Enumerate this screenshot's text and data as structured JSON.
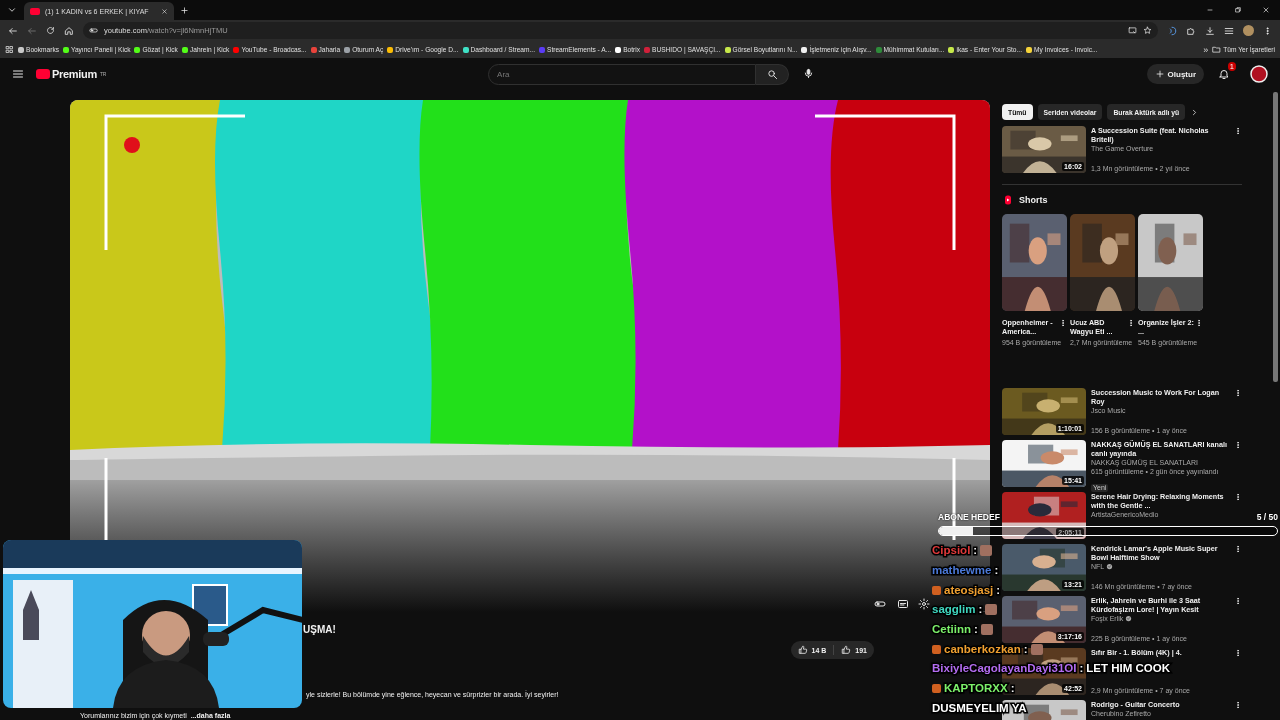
{
  "browser": {
    "tabs": [
      {
        "title": "(1) 1 KADIN vs 6 ERKEK | KIYAF",
        "selected": true
      }
    ],
    "address": {
      "host": "youtube.com",
      "path": "/watch?v=jl6NmnHjTMU"
    },
    "bookmarks": [
      {
        "label": "Bookmarks",
        "color": "#c8c8c8"
      },
      {
        "label": "Yayıncı Paneli | Kick",
        "color": "#53fc18"
      },
      {
        "label": "Gözat | Kick",
        "color": "#53fc18"
      },
      {
        "label": "Jahrein | Kick",
        "color": "#53fc18"
      },
      {
        "label": "YouTube - Broadcas...",
        "color": "#ff0000"
      },
      {
        "label": "Jaharia",
        "color": "#e8433b"
      },
      {
        "label": "Oturum Aç",
        "color": "#9aa0a6"
      },
      {
        "label": "Drive'ım - Google D...",
        "color": "#fbbc04"
      },
      {
        "label": "Dashboard / Stream...",
        "color": "#3fe0c5"
      },
      {
        "label": "StreamElements - A...",
        "color": "#5b3cf5"
      },
      {
        "label": "Botrix",
        "color": "#ffffff"
      },
      {
        "label": "BUSHIDO | SAVAŞÇI...",
        "color": "#d0203a"
      },
      {
        "label": "Görsel Boyutlarını N...",
        "color": "#c6e84a"
      },
      {
        "label": "İşletmeniz için Alışv...",
        "color": "#f0f0f0"
      },
      {
        "label": "Mühimmat Kutuları...",
        "color": "#2e8b3a"
      },
      {
        "label": "ikas - Enter Your Sto...",
        "color": "#c6e84a"
      },
      {
        "label": "My Invoices - Invoic...",
        "color": "#f5d33a"
      }
    ],
    "more_bookmarks": "»",
    "all_bookmarks": "Tüm Yer İşaretleri"
  },
  "youtube": {
    "logo": "Premium",
    "region": "TR",
    "search": {
      "placeholder": "Ara"
    },
    "create": "Oluştur",
    "notifications": "1"
  },
  "player": {
    "title": "UŞMA!",
    "likes": "14 B",
    "dislikes": "191",
    "description": "yle sizlerle! Bu bölümde yine eğlence, heyecan ve sürprizler bir arada. İyi seyirler!",
    "comment_note": "Yorumlarınız bizim için çok kıymeti",
    "more": "...daha fazla"
  },
  "sidebar": {
    "chips": [
      {
        "label": "Tümü",
        "selected": true
      },
      {
        "label": "Seriden videolar",
        "selected": false
      },
      {
        "label": "Burak Aktürk adlı yü",
        "selected": false
      }
    ],
    "feed": [
      {
        "kind": "video",
        "title": "A Succession Suite (feat. Nicholas Britell)",
        "channel": "The Game Overture",
        "meta": "1,3 Mn görüntüleme • 2 yıl önce",
        "duration": "16:02",
        "verified": false
      },
      {
        "kind": "shorts",
        "heading": "Shorts",
        "items": [
          {
            "title": "Oppenheimer - America...",
            "views": "954 B görüntüleme"
          },
          {
            "title": "Ucuz ABD Wagyu Eti ...",
            "views": "2,7 Mn görüntüleme"
          },
          {
            "title": "Organize İşler 2: ...",
            "views": "545 B görüntüleme"
          }
        ]
      },
      {
        "kind": "video",
        "title": "Succession Music to Work For Logan Roy",
        "channel": "Jsco Music",
        "meta": "156 B görüntüleme • 1 ay önce",
        "duration": "1:10:01",
        "verified": false
      },
      {
        "kind": "video",
        "title": "NAKKAŞ GÜMÜŞ EL SANATLARI kanalı canlı yayında",
        "channel": "NAKKAŞ GÜMÜŞ EL SANATLARI",
        "meta": "615 görüntüleme • 2 gün önce yayınlandı",
        "badge": "Yeni",
        "duration": "15:41",
        "verified": false
      },
      {
        "kind": "video",
        "title": "Serene Hair Drying: Relaxing Moments with the Gentle ...",
        "channel": "ArtistaGenericoMedio",
        "duration": "2:05:11",
        "verified": false
      },
      {
        "kind": "video",
        "title": "Kendrick Lamar's Apple Music Super Bowl Halftime Show",
        "channel": "NFL",
        "meta": "146 Mn görüntüleme • 7 ay önce",
        "duration": "13:21",
        "verified": true
      },
      {
        "kind": "video",
        "title": "Erlik, Jahrein ve Burhi ile 3 Saat Kürdofaşizm Lore! | Yayın Kesit",
        "channel": "Foşix Erlik",
        "meta": "225 B görüntüleme • 1 ay önce",
        "duration": "3:17:16",
        "verified": true
      },
      {
        "kind": "video",
        "title": "Sıfır Bir - 1. Bölüm (4K) | 4.",
        "meta": "2,9 Mn görüntüleme • 7 ay önce",
        "duration": "42:52",
        "verified": false
      },
      {
        "kind": "video",
        "title": "Rodrigo - Guitar Concerto",
        "channel": "Cherubino Zefiretto",
        "verified": false
      }
    ]
  },
  "overlay": {
    "goal": {
      "label": "ABONE HEDEF",
      "count": "5 / 50",
      "level": 0.1
    },
    "chat": [
      {
        "name": "Cipsiol",
        "color": "#e0393a",
        "sep": ":",
        "badge": false,
        "emote": true
      },
      {
        "name": "mathewme",
        "color": "#4b79d8",
        "sep": ":",
        "badge": false,
        "emote": false
      },
      {
        "name": "ateosjasj",
        "color": "#f0a030",
        "sep": ":",
        "badge": true,
        "emote": false
      },
      {
        "name": "sagglim",
        "color": "#3fd8c0",
        "sep": ":",
        "badge": false,
        "emote": true
      },
      {
        "name": "Cetiinn",
        "color": "#7cf06a",
        "sep": ":",
        "badge": false,
        "emote": true
      },
      {
        "name": "canberkozkan",
        "color": "#f0a030",
        "sep": ":",
        "badge": true,
        "emote": true
      },
      {
        "name": "BixiyleCagolayanDayi31OI",
        "color": "#b36cf0",
        "sep": ":",
        "text": "LET HIM COOK",
        "badge": false,
        "emote": false
      },
      {
        "name": "KAPTORXX",
        "color": "#7cf06a",
        "sep": ":",
        "text": "DUSMEYELIM YA",
        "badge": true,
        "emote": false
      }
    ]
  }
}
